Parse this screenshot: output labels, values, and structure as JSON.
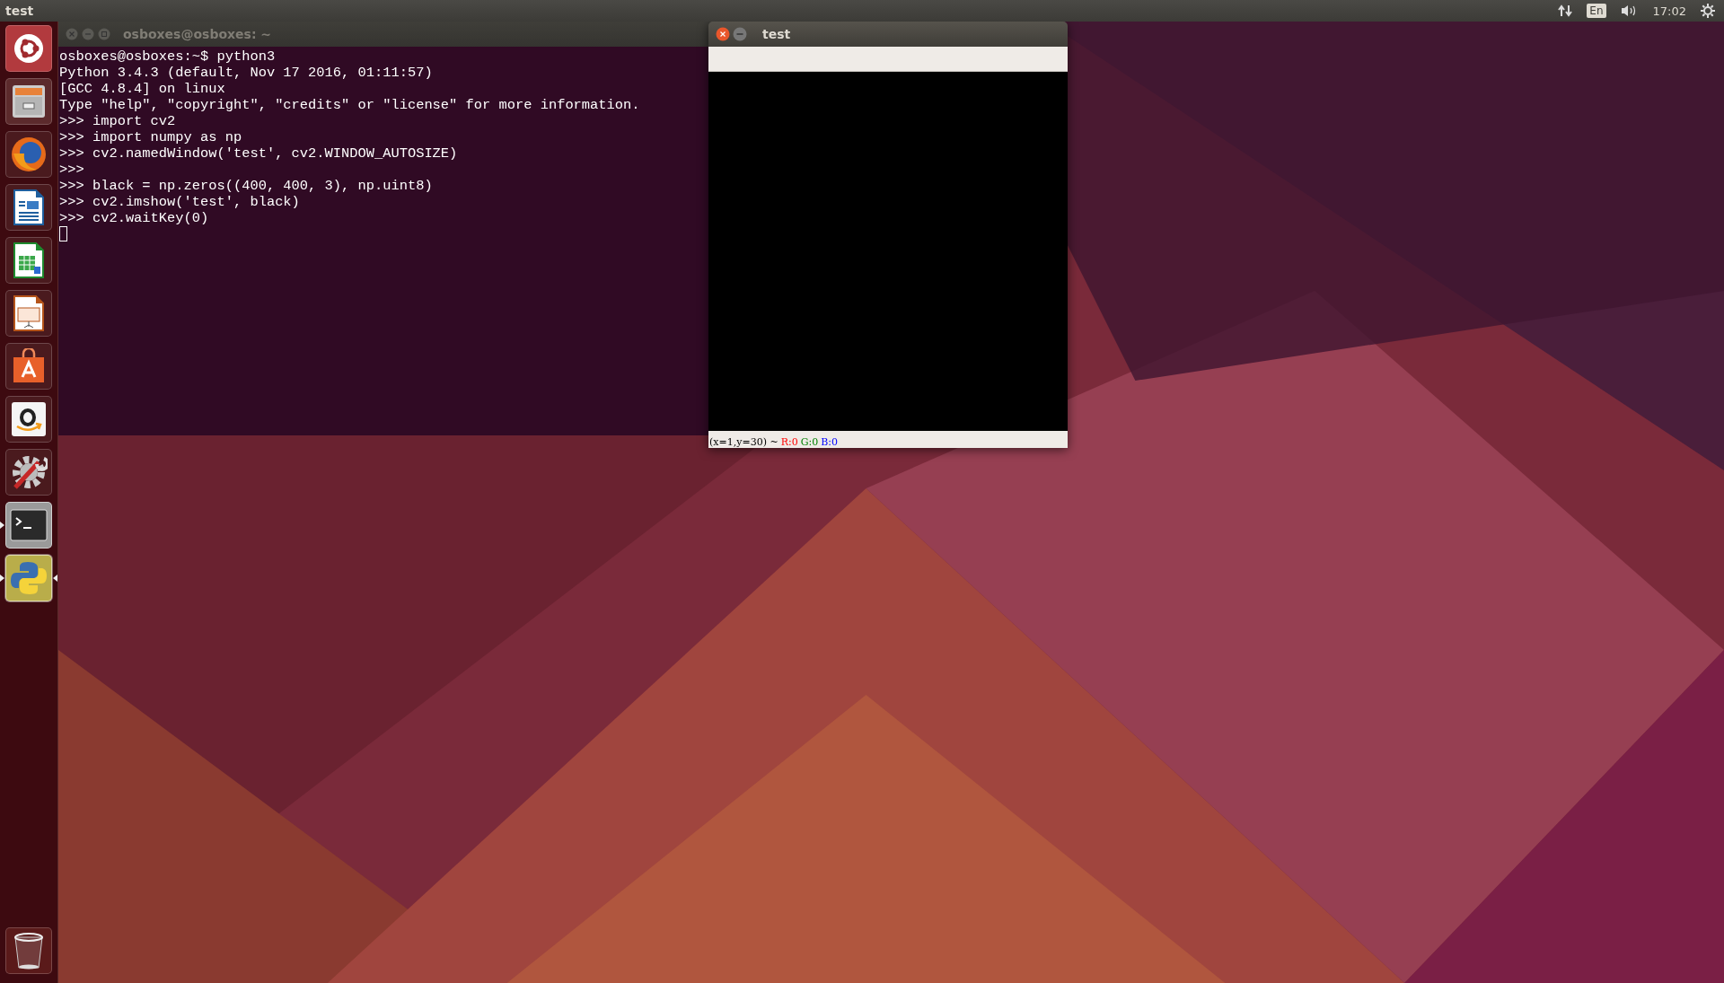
{
  "top_panel": {
    "title": "test",
    "keyboard_layout": "En",
    "clock": "17:02"
  },
  "launcher": [
    {
      "kind": "dash",
      "running": false,
      "focused": false
    },
    {
      "kind": "files",
      "running": false,
      "focused": false
    },
    {
      "kind": "browser",
      "running": false,
      "focused": false
    },
    {
      "kind": "writer",
      "running": false,
      "focused": false
    },
    {
      "kind": "calc",
      "running": false,
      "focused": false
    },
    {
      "kind": "impress",
      "running": false,
      "focused": false
    },
    {
      "kind": "software",
      "running": false,
      "focused": false
    },
    {
      "kind": "amazon",
      "running": false,
      "focused": false
    },
    {
      "kind": "settings",
      "running": false,
      "focused": false
    },
    {
      "kind": "terminal",
      "running": true,
      "focused": false
    },
    {
      "kind": "python",
      "running": true,
      "focused": true
    },
    {
      "kind": "trash",
      "running": false,
      "focused": false
    }
  ],
  "terminal_window": {
    "title": "osboxes@osboxes: ~",
    "lines": [
      "osboxes@osboxes:~$ python3",
      "Python 3.4.3 (default, Nov 17 2016, 01:11:57)",
      "[GCC 4.8.4] on linux",
      "Type \"help\", \"copyright\", \"credits\" or \"license\" for more information.",
      ">>> import cv2",
      ">>> import numpy as np",
      ">>> cv2.namedWindow('test', cv2.WINDOW_AUTOSIZE)",
      ">>>",
      ">>> black = np.zeros((400, 400, 3), np.uint8)",
      ">>> cv2.imshow('test', black)",
      ">>> cv2.waitKey(0)"
    ]
  },
  "image_window": {
    "title": "test",
    "status_parts": [
      {
        "text": "(x=1,y=30) ~",
        "color": "#000000"
      },
      {
        "text": "R:0",
        "color": "#ff0000"
      },
      {
        "text": "G:0",
        "color": "#008000"
      },
      {
        "text": "B:0",
        "color": "#0000ff"
      }
    ]
  }
}
